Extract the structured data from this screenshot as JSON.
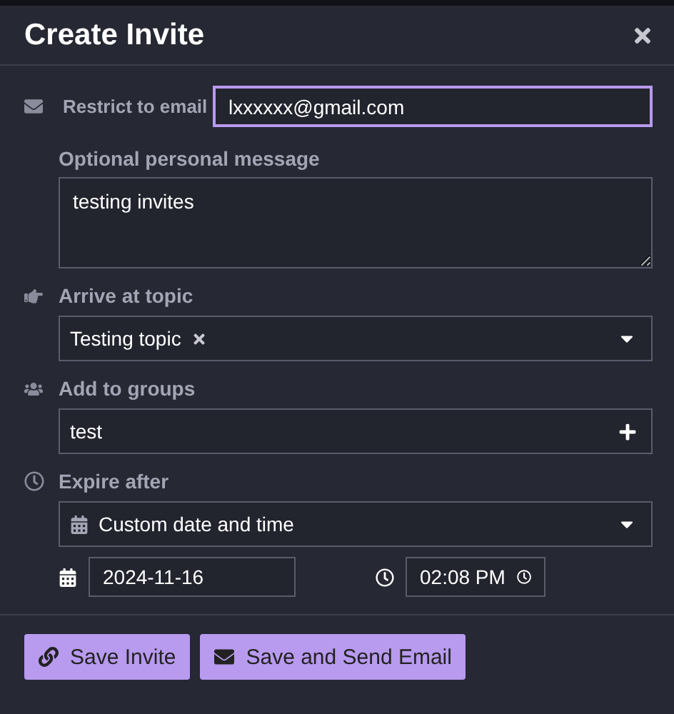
{
  "dialog": {
    "title": "Create Invite"
  },
  "email": {
    "label": "Restrict to email",
    "value": "lxxxxxx@gmail.com",
    "focused": true
  },
  "message": {
    "label": "Optional personal message",
    "value": "testing invites"
  },
  "topic": {
    "label": "Arrive at topic",
    "tags": [
      {
        "label": "Testing topic"
      }
    ]
  },
  "groups": {
    "label": "Add to groups",
    "value": "test"
  },
  "expire": {
    "label": "Expire after",
    "option": "Custom date and time",
    "date": "2024-11-16",
    "time": "02:08 PM"
  },
  "buttons": [
    {
      "label": "Save Invite",
      "kind": "link"
    },
    {
      "label": "Save and Send Email",
      "kind": "email"
    }
  ]
}
